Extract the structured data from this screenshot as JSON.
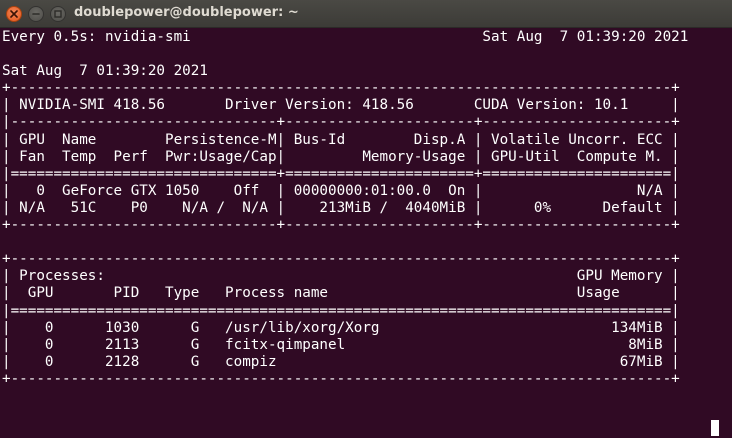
{
  "window": {
    "title": "doublepower@doublepower: ~",
    "buttons": {
      "close_icon": "close-icon",
      "minimize_icon": "minimize-icon",
      "maximize_icon": "maximize-icon"
    }
  },
  "colors": {
    "terminal_background": "#300a24",
    "terminal_foreground": "#ffffff",
    "close_button": "#e95420"
  },
  "terminal": {
    "lines": [
      "Every 0.5s: nvidia-smi                                  Sat Aug  7 01:39:20 2021",
      "",
      "Sat Aug  7 01:39:20 2021",
      "+-----------------------------------------------------------------------------+",
      "| NVIDIA-SMI 418.56       Driver Version: 418.56       CUDA Version: 10.1     |",
      "|-------------------------------+----------------------+----------------------+",
      "| GPU  Name        Persistence-M| Bus-Id        Disp.A | Volatile Uncorr. ECC |",
      "| Fan  Temp  Perf  Pwr:Usage/Cap|         Memory-Usage | GPU-Util  Compute M. |",
      "|===============================+======================+======================|",
      "|   0  GeForce GTX 1050    Off  | 00000000:01:00.0  On |                  N/A |",
      "| N/A   51C    P0    N/A /  N/A |    213MiB /  4040MiB |      0%      Default |",
      "+-------------------------------+----------------------+----------------------+",
      "",
      "+-----------------------------------------------------------------------------+",
      "| Processes:                                                       GPU Memory |",
      "|  GPU       PID   Type   Process name                             Usage      |",
      "|=============================================================================|",
      "|    0      1030      G   /usr/lib/xorg/Xorg                           134MiB |",
      "|    0      2113      G   fcitx-qimpanel                                 8MiB |",
      "|    0      2128      G   compiz                                        67MiB |",
      "+-----------------------------------------------------------------------------+"
    ]
  }
}
